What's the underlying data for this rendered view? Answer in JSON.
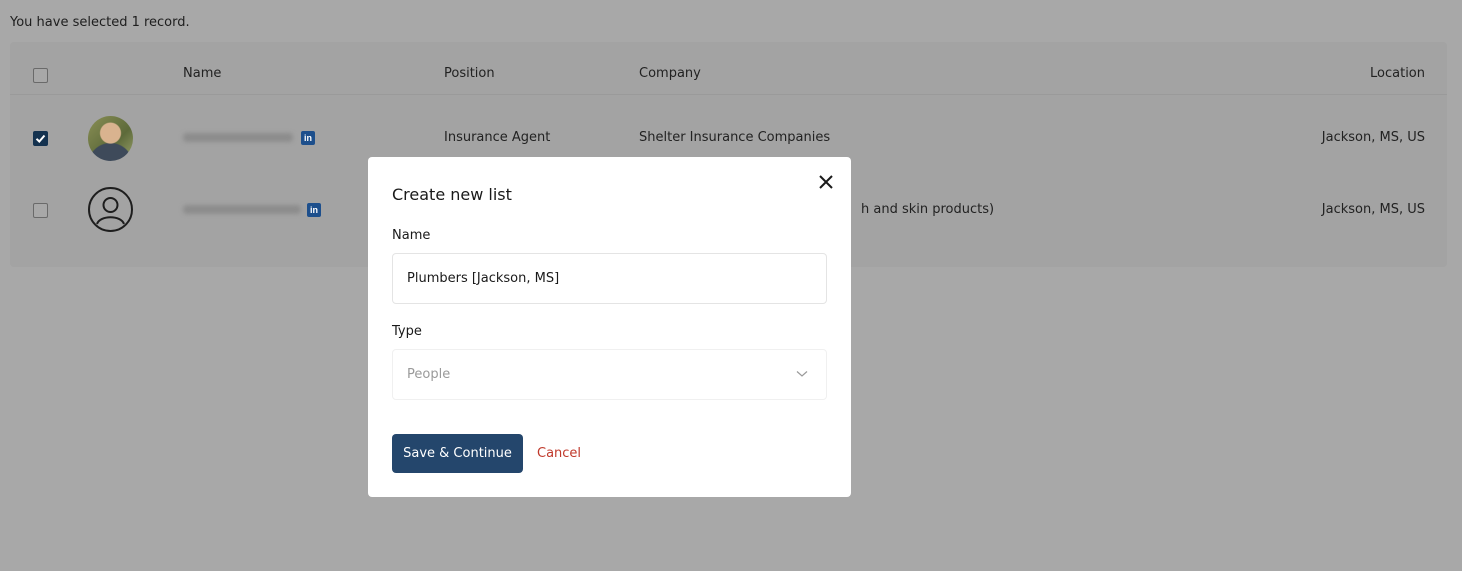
{
  "selection": {
    "note": "You have selected 1 record."
  },
  "table": {
    "columns": {
      "name": "Name",
      "position": "Position",
      "company": "Company",
      "location": "Location"
    },
    "rows": [
      {
        "checked": true,
        "avatar": "photo",
        "position": "Insurance Agent",
        "company": "Shelter Insurance Companies",
        "location": "Jackson, MS, US"
      },
      {
        "checked": false,
        "avatar": "generic-user-icon",
        "position": "",
        "company": "h and skin products)",
        "location": "Jackson, MS, US"
      }
    ]
  },
  "modal": {
    "title": "Create new list",
    "name_label": "Name",
    "name_value": "Plumbers [Jackson, MS]",
    "type_label": "Type",
    "type_value": "People",
    "save_label": "Save & Continue",
    "cancel_label": "Cancel"
  },
  "colors": {
    "primary": "#24466c",
    "cancel": "#c0392b",
    "linkedin": "#1d4f8c",
    "overlay": "#a8a8a8"
  }
}
